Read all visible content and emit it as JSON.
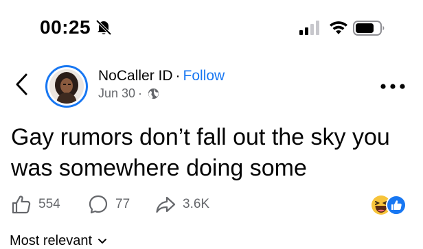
{
  "status_bar": {
    "time": "00:25",
    "icons": [
      "bell-slash-icon",
      "cellular-signal-icon",
      "wifi-icon",
      "battery-icon"
    ]
  },
  "post": {
    "author": "NoCaller ID",
    "separator": "·",
    "follow_label": "Follow",
    "date": "Jun 30",
    "meta_separator": "·",
    "audience_icon": "globe-icon",
    "text": "Gay rumors don’t fall out the sky you was somewhere doing some"
  },
  "reactions": {
    "likes": "554",
    "comments": "77",
    "shares": "3.6K",
    "summary_icons": [
      "haha-emoji-icon",
      "like-badge-icon"
    ]
  },
  "comments_sort": {
    "label": "Most relevant"
  },
  "colors": {
    "accent": "#1877f2",
    "secondary_text": "#65676b",
    "primary_text": "#050505",
    "background": "#ffffff"
  }
}
